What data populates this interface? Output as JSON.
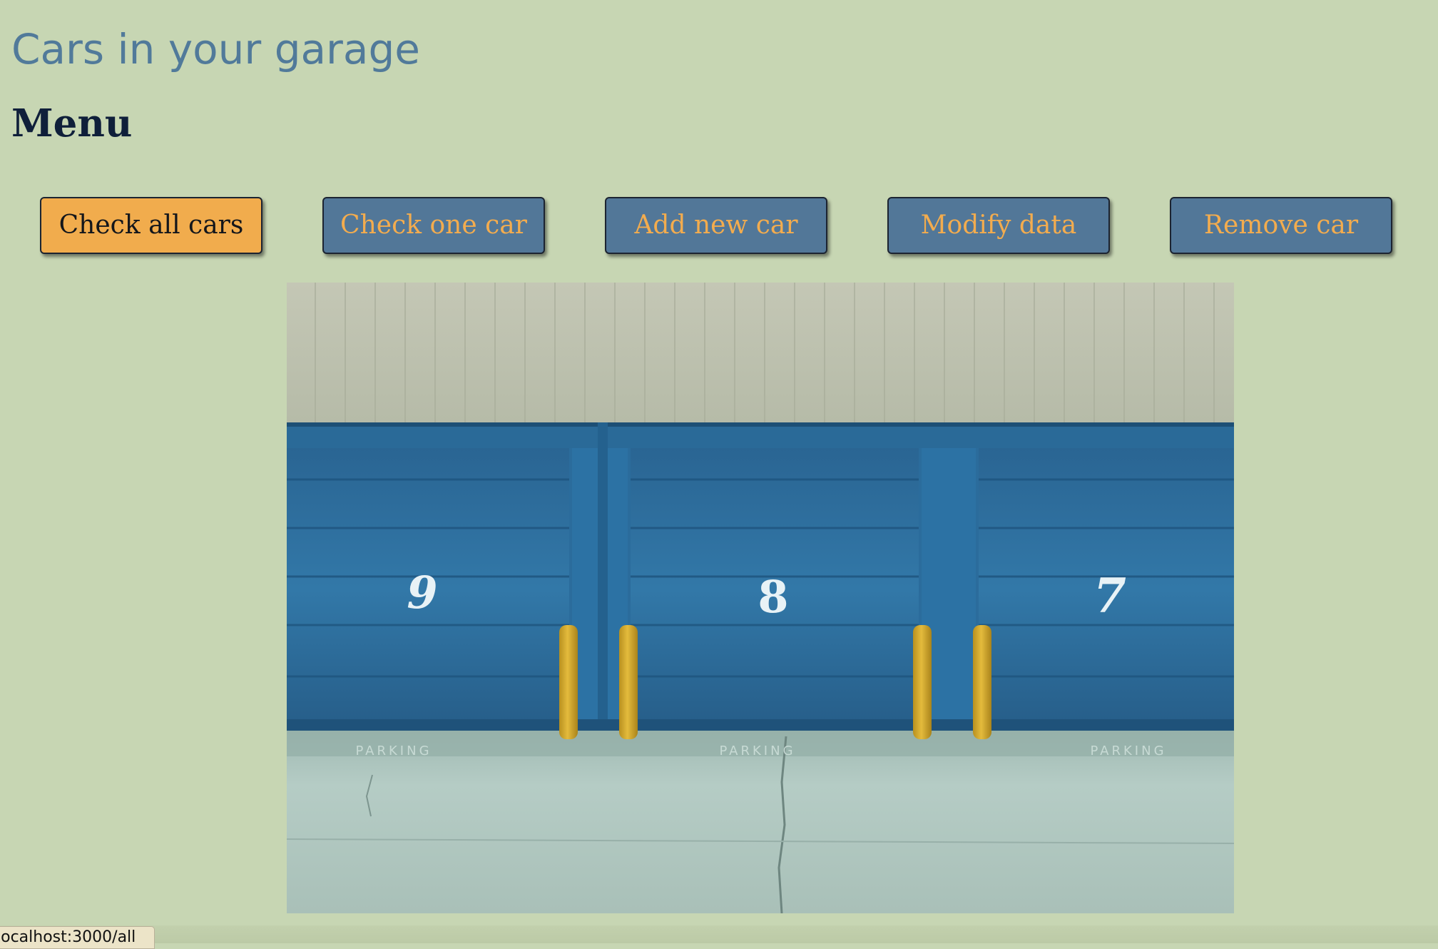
{
  "header": {
    "title": "Cars in your garage",
    "menu_heading": "Menu"
  },
  "menu": {
    "buttons": [
      {
        "label": "Check all cars",
        "active": true
      },
      {
        "label": "Check one car",
        "active": false
      },
      {
        "label": "Add new car",
        "active": false
      },
      {
        "label": "Modify data",
        "active": false
      },
      {
        "label": "Remove car",
        "active": false
      }
    ]
  },
  "hero_image": {
    "door_numbers": [
      "9",
      "8",
      "7"
    ],
    "ground_text": [
      "PARKING",
      "PARKING",
      "PARKING"
    ]
  },
  "status_bar": {
    "link_url": "localhost:3000/all"
  },
  "colors": {
    "background": "#c7d6b3",
    "title": "#517a9a",
    "heading": "#0f1f3a",
    "button": "#527798",
    "button_text": "#f3ac4e",
    "button_active": "#f1ac4d",
    "door_blue": "#2f6e9e",
    "bollard_yellow": "#d9ad2e"
  }
}
